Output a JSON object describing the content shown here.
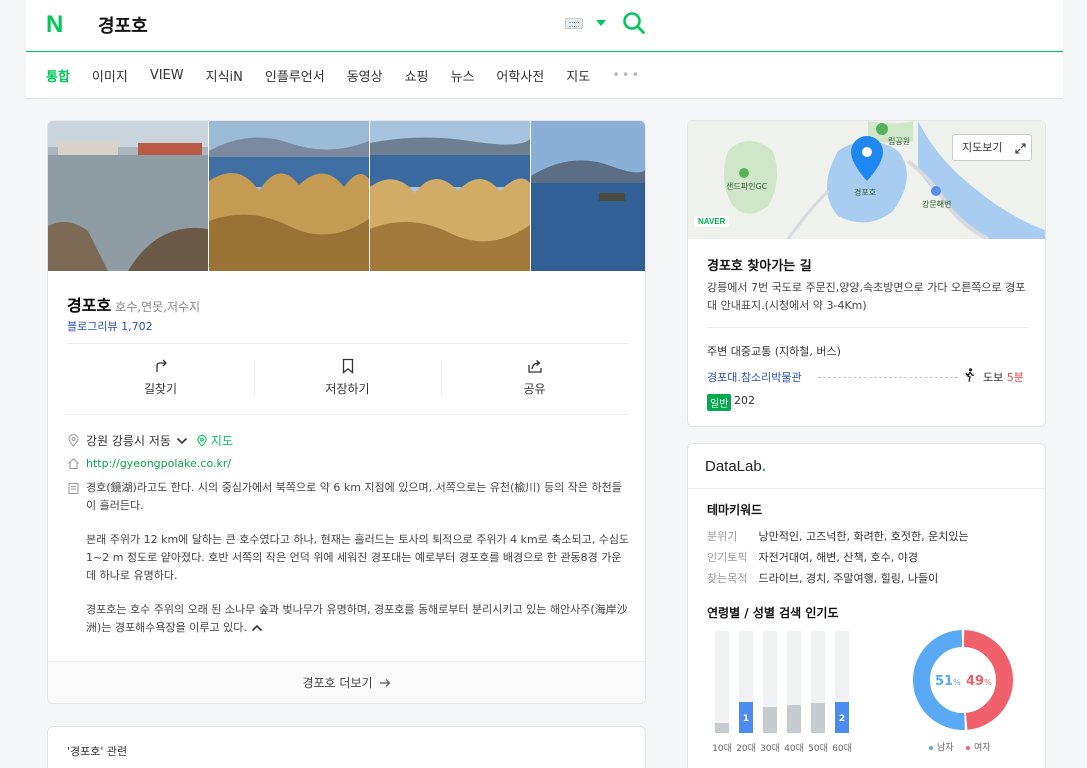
{
  "header": {
    "logo": "N",
    "query": "경포호"
  },
  "tabs": [
    {
      "label": "통합",
      "active": true
    },
    {
      "label": "이미지"
    },
    {
      "label": "VIEW"
    },
    {
      "label": "지식iN"
    },
    {
      "label": "인플루언서"
    },
    {
      "label": "동영상"
    },
    {
      "label": "쇼핑"
    },
    {
      "label": "뉴스"
    },
    {
      "label": "어학사전"
    },
    {
      "label": "지도"
    },
    {
      "label": "•••"
    }
  ],
  "place": {
    "name": "경포호",
    "category": "호수,연못,저수지",
    "blog_review_label": "블로그리뷰",
    "blog_review_count": "1,702",
    "actions": {
      "directions": "길찾기",
      "save": "저장하기",
      "share": "공유"
    },
    "address": "강원 강릉시 저동",
    "map_link": "지도",
    "url": "http://gyeongpolake.co.kr/",
    "description": [
      "경호(鏡湖)라고도 한다. 시의 중심가에서 북쪽으로 약 6 km 지점에 있으며, 서쪽으로는 유천(楡川) 등의 작은 하천들이 흘러든다.",
      "본래 주위가 12 km에 달하는 큰 호수였다고 하나, 현재는 흘러드는 토사의 퇴적으로 주위가 4 km로 축소되고, 수심도 1~2 m 정도로 얕아졌다. 호반 서쪽의 작은 언덕 위에 세워진 경포대는 예로부터 경포호를 배경으로 한 관동8경 가운데 하나로 유명하다.",
      "경포호는 호수 주위의 오래 된 소나무 숲과 벚나무가 유명하며, 경포호를 동해로부터 분리시키고 있는 해안사주(海岸沙洲)는 경포해수욕장을 이루고 있다."
    ],
    "more_label": "경포호 더보기"
  },
  "related": {
    "label": "'경포호' 관련"
  },
  "map_card": {
    "map_view_button": "지도보기",
    "naver_badge": "NAVER",
    "map_labels": {
      "park": "립공원",
      "golf": "샌드파인GC",
      "lake": "경포호",
      "beach": "강문해변"
    },
    "directions_title": "경포호 찾아가는 길",
    "directions_text": "강릉에서 7번 국도로 주문진,양양,속초방면으로 가다 오른쪽으로 경포대 안내표지.(시청에서 약 3-4Km)",
    "transit_title": "주변 대중교통 (지하철, 버스)",
    "transit_stop": "경포대.참소리박물관",
    "walk_label": "도보",
    "walk_min": "5분",
    "bus_type": "일반",
    "bus_no": "202"
  },
  "datalab": {
    "logo": "DataLab",
    "logo_dot": ".",
    "theme_title": "테마키워드",
    "keywords": [
      {
        "key": "분위기",
        "value": "낭만적인, 고즈넉한, 화려한, 호젓한, 운치있는"
      },
      {
        "key": "인기토픽",
        "value": "자전거대여, 해변, 산책, 호수, 야경"
      },
      {
        "key": "찾는목적",
        "value": "드라이브, 경치, 주말여행, 힐링, 나들이"
      }
    ],
    "popularity_title": "연령별 / 성별 검색 인기도",
    "colors": {
      "highlight": "#4c8cf0",
      "bar": "#c6cbd0",
      "male": "#5aa9f5",
      "female": "#f0616b"
    }
  },
  "chart_data": [
    {
      "type": "bar",
      "categories": [
        "10대",
        "20대",
        "30대",
        "40대",
        "50대",
        "60대"
      ],
      "values": [
        10,
        30,
        25,
        27,
        29,
        30
      ],
      "ranks": [
        "",
        "1",
        "",
        "",
        "",
        "2"
      ],
      "ylim": [
        0,
        100
      ]
    },
    {
      "type": "pie",
      "series": [
        {
          "name": "남자",
          "value": 51
        },
        {
          "name": "여자",
          "value": 49
        }
      ],
      "pct_suffix": "%"
    }
  ]
}
